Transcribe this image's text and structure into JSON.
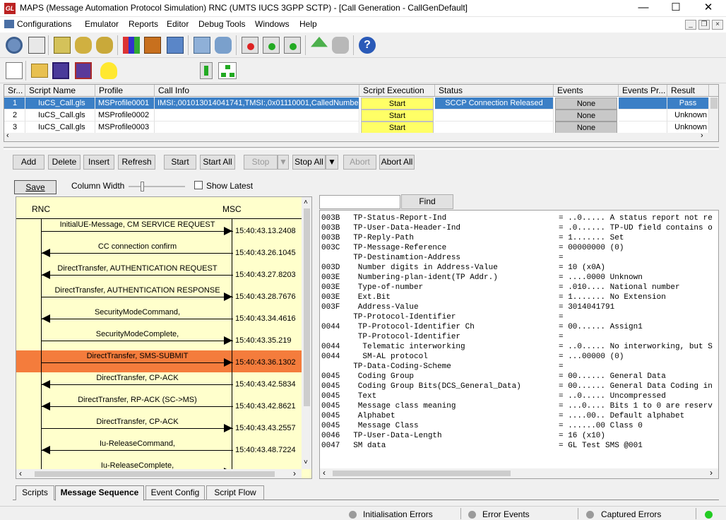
{
  "window": {
    "title": "MAPS (Message Automation Protocol Simulation) RNC (UMTS IUCS 3GPP SCTP) - [Call Generation  - CallGenDefault]",
    "app_icon_text": "GL"
  },
  "menu": [
    "Configurations",
    "Emulator",
    "Reports",
    "Editor",
    "Debug Tools",
    "Windows",
    "Help"
  ],
  "grid": {
    "columns": [
      "Sr...",
      "Script Name",
      "Profile",
      "Call Info",
      "Script Execution",
      "Status",
      "Events",
      "Events Pr...",
      "Result"
    ],
    "rows": [
      {
        "sr": "1",
        "script": "IuCS_Call.gls",
        "profile": "MSProfile0001",
        "info": "IMSI:,001013014041741,TMSI:,0x01110001,CalledNumbe...",
        "exec": "Start",
        "status": "SCCP Connection Released",
        "events": "None",
        "events_pr": "",
        "result": "Pass"
      },
      {
        "sr": "2",
        "script": "IuCS_Call.gls",
        "profile": "MSProfile0002",
        "info": "",
        "exec": "Start",
        "status": "",
        "events": "None",
        "events_pr": "",
        "result": "Unknown"
      },
      {
        "sr": "3",
        "script": "IuCS_Call.gls",
        "profile": "MSProfile0003",
        "info": "",
        "exec": "Start",
        "status": "",
        "events": "None",
        "events_pr": "",
        "result": "Unknown"
      }
    ]
  },
  "buttons": {
    "add": "Add",
    "delete": "Delete",
    "insert": "Insert",
    "refresh": "Refresh",
    "start": "Start",
    "start_all": "Start All",
    "stop": "Stop",
    "stop_all": "Stop All",
    "abort": "Abort",
    "abort_all": "Abort All"
  },
  "seq_controls": {
    "save": "Save",
    "column_width": "Column Width",
    "show_latest": "Show Latest",
    "find": "Find",
    "find_value": ""
  },
  "sequence": {
    "left_entity": "RNC",
    "right_entity": "MSC",
    "messages": [
      {
        "label": "InitialUE-Message, CM SERVICE REQUEST",
        "dir": "right",
        "time": "15:40:43.13.2408",
        "highlight": false
      },
      {
        "label": "CC connection confirm",
        "dir": "left",
        "time": "15:40:43.26.1045",
        "highlight": false
      },
      {
        "label": "DirectTransfer, AUTHENTICATION REQUEST",
        "dir": "left",
        "time": "15:40:43.27.8203",
        "highlight": false
      },
      {
        "label": "DirectTransfer, AUTHENTICATION RESPONSE",
        "dir": "right",
        "time": "15:40:43.28.7676",
        "highlight": false
      },
      {
        "label": "SecurityModeCommand,",
        "dir": "left",
        "time": "15:40:43.34.4616",
        "highlight": false
      },
      {
        "label": "SecurityModeComplete,",
        "dir": "right",
        "time": "15:40:43.35.219",
        "highlight": false
      },
      {
        "label": "DirectTransfer, SMS-SUBMIT",
        "dir": "right",
        "time": "15:40:43.36.1302",
        "highlight": true
      },
      {
        "label": "DirectTransfer, CP-ACK",
        "dir": "left",
        "time": "15:40:43.42.5834",
        "highlight": false
      },
      {
        "label": "DirectTransfer, RP-ACK (SC->MS)",
        "dir": "left",
        "time": "15:40:43.42.8621",
        "highlight": false
      },
      {
        "label": "DirectTransfer, CP-ACK",
        "dir": "right",
        "time": "15:40:43.43.2557",
        "highlight": false
      },
      {
        "label": "Iu-ReleaseCommand,",
        "dir": "left",
        "time": "15:40:43.48.7224",
        "highlight": false
      },
      {
        "label": "Iu-ReleaseComplete,",
        "dir": "right",
        "time": "",
        "highlight": false
      }
    ]
  },
  "decode_lines": [
    {
      "off": "003B",
      "field": "  TP-Status-Report-Ind",
      "value": "= ..0..... A status report not re"
    },
    {
      "off": "003B",
      "field": "  TP-User-Data-Header-Ind",
      "value": "= .0...... TP-UD field contains o"
    },
    {
      "off": "003B",
      "field": "  TP-Reply-Path",
      "value": "= 1....... Set"
    },
    {
      "off": "003C",
      "field": "  TP-Message-Reference",
      "value": "= 00000000 (0)"
    },
    {
      "off": "",
      "field": "  TP-Destinamtion-Address",
      "value": "="
    },
    {
      "off": "003D",
      "field": "   Number digits in Address-Value",
      "value": "= 10 (x0A)"
    },
    {
      "off": "003E",
      "field": "   Numbering-plan-ident(TP Addr.)",
      "value": "= ....0000 Unknown"
    },
    {
      "off": "003E",
      "field": "   Type-of-number",
      "value": "= .010.... National number"
    },
    {
      "off": "003E",
      "field": "   Ext.Bit",
      "value": "= 1....... No Extension"
    },
    {
      "off": "003F",
      "field": "   Address-Value",
      "value": "= 3014041791"
    },
    {
      "off": "",
      "field": "  TP-Protocol-Identifier",
      "value": "="
    },
    {
      "off": "0044",
      "field": "   TP-Protocol-Identifier Ch",
      "value": "= 00...... Assign1"
    },
    {
      "off": "",
      "field": "   TP-Protocol-Identifier",
      "value": "="
    },
    {
      "off": "0044",
      "field": "    Telematic interworking",
      "value": "= ..0..... No interworking, but S"
    },
    {
      "off": "0044",
      "field": "    SM-AL protocol",
      "value": "= ...00000 (0)"
    },
    {
      "off": "",
      "field": "  TP-Data-Coding-Scheme",
      "value": "="
    },
    {
      "off": "0045",
      "field": "   Coding Group",
      "value": "= 00...... General Data"
    },
    {
      "off": "0045",
      "field": "   Coding Group Bits(DCS_General_Data)",
      "value": "= 00...... General Data Coding in"
    },
    {
      "off": "0045",
      "field": "   Text",
      "value": "= ..0..... Uncompressed"
    },
    {
      "off": "0045",
      "field": "   Message class meaning",
      "value": "= ...0.... Bits 1 to 0 are reserv"
    },
    {
      "off": "0045",
      "field": "   Alphabet",
      "value": "= ....00.. Default alphabet"
    },
    {
      "off": "0045",
      "field": "   Message Class",
      "value": "= ......00 Class 0"
    },
    {
      "off": "0046",
      "field": "  TP-User-Data-Length",
      "value": "= 16 (x10)"
    },
    {
      "off": "0047",
      "field": "  SM data",
      "value": "= GL Test SMS @001"
    }
  ],
  "tabs": [
    "Scripts",
    "Message Sequence",
    "Event Config",
    "Script Flow"
  ],
  "status": {
    "init_errors": "Initialisation Errors",
    "error_events": "Error Events",
    "captured_errors": "Captured Errors"
  },
  "colors": {
    "highlight_row": "#f47c3c",
    "selection": "#3b7fc6",
    "seq_bg": "#ffffcc",
    "status_green": "#22cc22"
  }
}
